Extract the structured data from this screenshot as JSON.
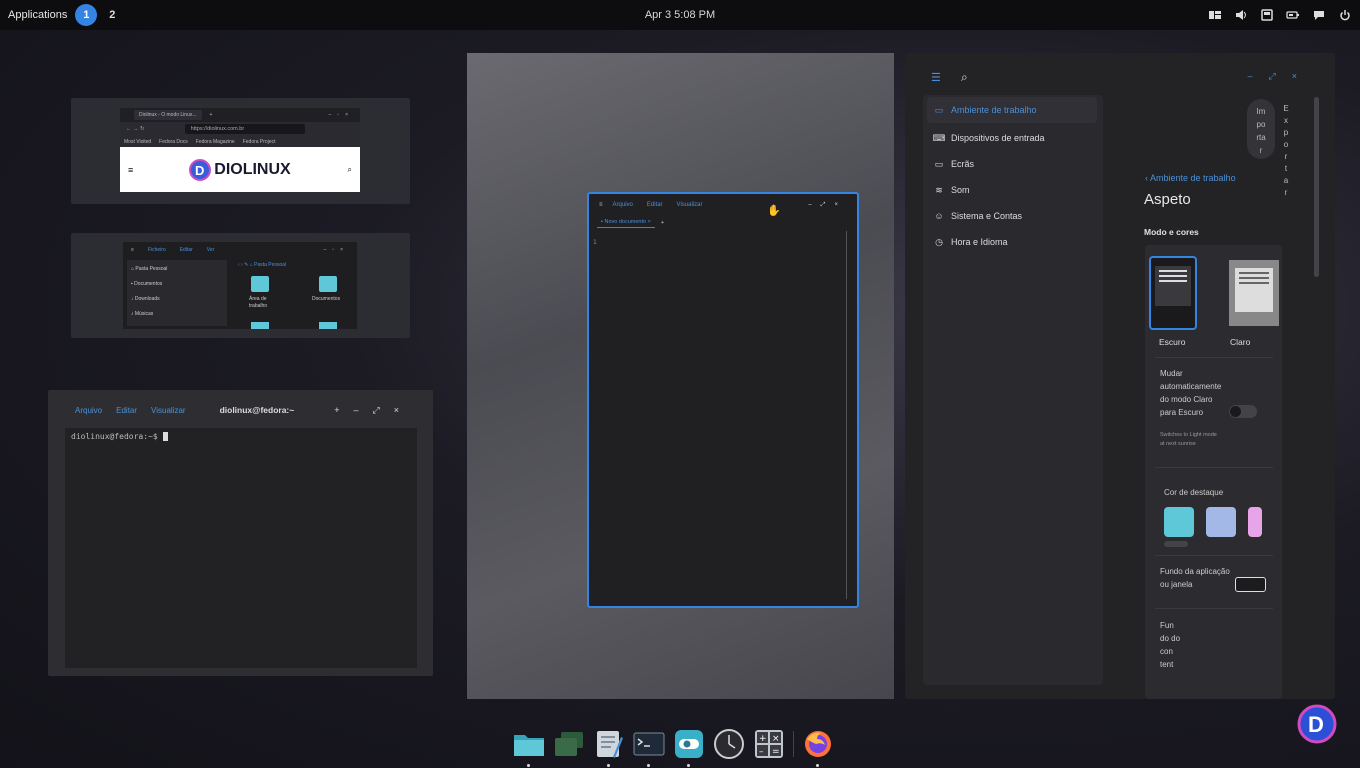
{
  "topbar": {
    "applications_label": "Applications",
    "workspace_active": "1",
    "workspace_other": "2",
    "clock": "Apr 3  5:08 PM"
  },
  "browser_thumb": {
    "tab_title": "Diolinux - O modo Linux...",
    "url": "https://diolinux.com.br",
    "bookmarks": [
      "Most Visited",
      "Fedora Docs",
      "Fedora Magazine",
      "Fedora Project"
    ],
    "logo_text": "DIOLINUX"
  },
  "files_thumb": {
    "menus": [
      "Ficheiro",
      "Editar",
      "Ver"
    ],
    "path": "Pasta Pessoal",
    "sidebar": [
      "Pasta Pessoal",
      "Documentos",
      "Downloads",
      "Músicas"
    ],
    "items": [
      "Área de trabalho",
      "Documentos"
    ]
  },
  "terminal": {
    "menus": [
      "Arquivo",
      "Editar",
      "Visualizar"
    ],
    "title": "diolinux@fedora:~",
    "prompt": "diolinux@fedora:~$ "
  },
  "text_editor": {
    "menus": [
      "Arquivo",
      "Editar",
      "Visualizar"
    ],
    "tab_label": "Novo documento",
    "line_number": "1"
  },
  "settings": {
    "sidebar": [
      {
        "label": "Ambiente de trabalho",
        "icon": "monitor-icon"
      },
      {
        "label": "Dispositivos de entrada",
        "icon": "keyboard-icon"
      },
      {
        "label": "Ecrãs",
        "icon": "display-icon"
      },
      {
        "label": "Som",
        "icon": "sound-icon"
      },
      {
        "label": "Sistema e Contas",
        "icon": "users-icon"
      },
      {
        "label": "Hora e Idioma",
        "icon": "clock-icon"
      }
    ],
    "import_label": "Im\npo\nrta\nr",
    "export_label": "E\nx\np\no\nr\nt\na\nr",
    "back_label": "Ambiente de trabalho",
    "page_title": "Aspeto",
    "section_mode": "Modo e cores",
    "theme_dark": "Escuro",
    "theme_light": "Claro",
    "auto_switch_title": "Mudar automaticamente do modo Claro para Escuro",
    "auto_switch_desc": "Switches to Light mode at next sunrise",
    "accent_label": "Cor de destaque",
    "accent_colors": [
      "#5ec8d8",
      "#a4b8e8",
      "#e8a4e8"
    ],
    "app_bg_label": "Fundo da aplicação ou janela",
    "content_label": "Fun do do con tent"
  },
  "dock": [
    "files-icon",
    "workspaces-icon",
    "text-editor-icon",
    "terminal-icon",
    "settings-app-icon",
    "clock-app-icon",
    "calculator-icon",
    "firefox-icon"
  ]
}
